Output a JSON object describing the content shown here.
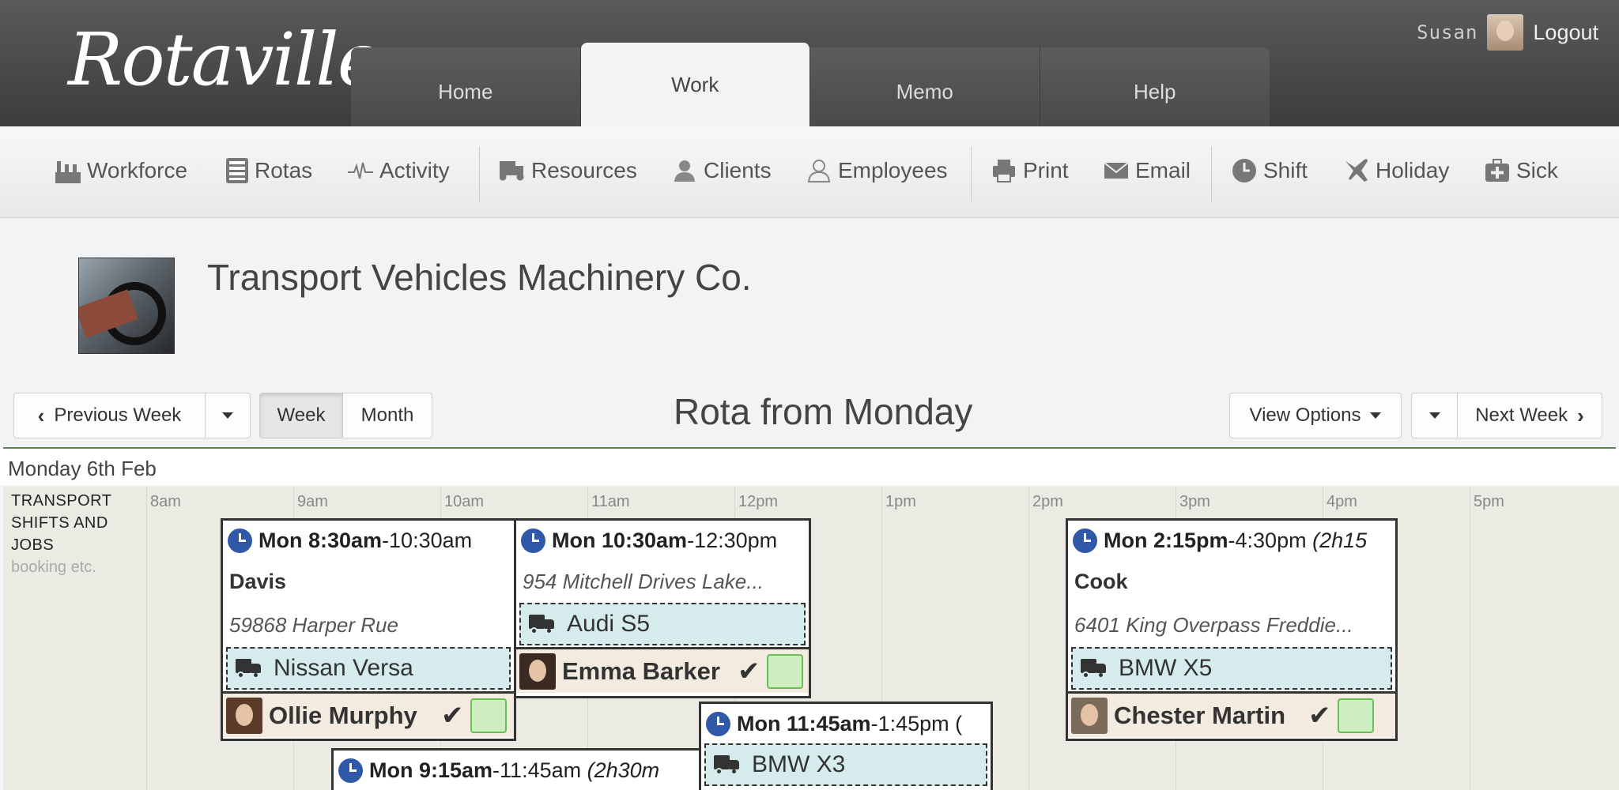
{
  "app": {
    "logo": "Rotaville"
  },
  "header": {
    "tabs": [
      {
        "label": "Home"
      },
      {
        "label": "Work"
      },
      {
        "label": "Memo"
      },
      {
        "label": "Help"
      }
    ],
    "active_tab": "Work",
    "user": {
      "name": "Susan",
      "logout_label": "Logout"
    }
  },
  "toolbar": {
    "items": [
      {
        "label": "Workforce",
        "icon": "factory-icon"
      },
      {
        "label": "Rotas",
        "icon": "clipboard-icon"
      },
      {
        "label": "Activity",
        "icon": "pulse-icon"
      },
      {
        "label": "Resources",
        "icon": "truck-icon"
      },
      {
        "label": "Clients",
        "icon": "client-icon"
      },
      {
        "label": "Employees",
        "icon": "user-icon"
      },
      {
        "label": "Print",
        "icon": "printer-icon"
      },
      {
        "label": "Email",
        "icon": "envelope-icon"
      },
      {
        "label": "Shift",
        "icon": "clock-icon"
      },
      {
        "label": "Holiday",
        "icon": "plane-icon"
      },
      {
        "label": "Sick",
        "icon": "medkit-icon"
      }
    ]
  },
  "company": {
    "name": "Transport Vehicles Machinery Co."
  },
  "nav": {
    "prev_label": "Previous Week",
    "week_label": "Week",
    "month_label": "Month",
    "title": "Rota from Monday",
    "view_options_label": "View Options",
    "next_label": "Next Week",
    "active_view": "Week"
  },
  "grid": {
    "day_label": "Monday 6th Feb",
    "row_title": "TRANSPORT SHIFTS AND JOBS",
    "row_title_lines": [
      "TRANSPORT",
      "SHIFTS AND",
      "JOBS"
    ],
    "row_subtitle": "booking etc.",
    "hours": [
      "8am",
      "9am",
      "10am",
      "11am",
      "12pm",
      "1pm",
      "2pm",
      "3pm",
      "4pm",
      "5pm"
    ]
  },
  "shifts": [
    {
      "start": "Mon 8:30am",
      "end": "-10:30am",
      "client": "Davis",
      "address": "59868 Harper Rue",
      "vehicle": "Nissan Versa",
      "employee": "Ollie Murphy",
      "confirmed": true
    },
    {
      "start": "Mon 10:30am",
      "end": "-12:30pm",
      "address": "954 Mitchell Drives Lake...",
      "vehicle": "Audi S5",
      "employee": "Emma Barker",
      "confirmed": true
    },
    {
      "start": "Mon 2:15pm",
      "end": "-4:30pm",
      "duration": "(2h15",
      "client": "Cook",
      "address": "6401 King Overpass Freddie...",
      "vehicle": "BMW X5",
      "employee": "Chester Martin",
      "confirmed": true
    },
    {
      "start": "Mon 11:45am",
      "end": "-1:45pm",
      "duration": "(",
      "vehicle": "BMW X3"
    },
    {
      "start": "Mon 9:15am",
      "end": "-11:45am",
      "duration": "(2h30m"
    }
  ],
  "colors": {
    "header_bg": "#4a4a4a",
    "clock_blue": "#2f58a8",
    "vehicle_bg": "#d6ecec",
    "employee_bg": "#f3ebdf",
    "checkbox_green": "#cdeec0",
    "rule_green": "#5c8a4a",
    "grid_bg": "#ebebe3"
  }
}
